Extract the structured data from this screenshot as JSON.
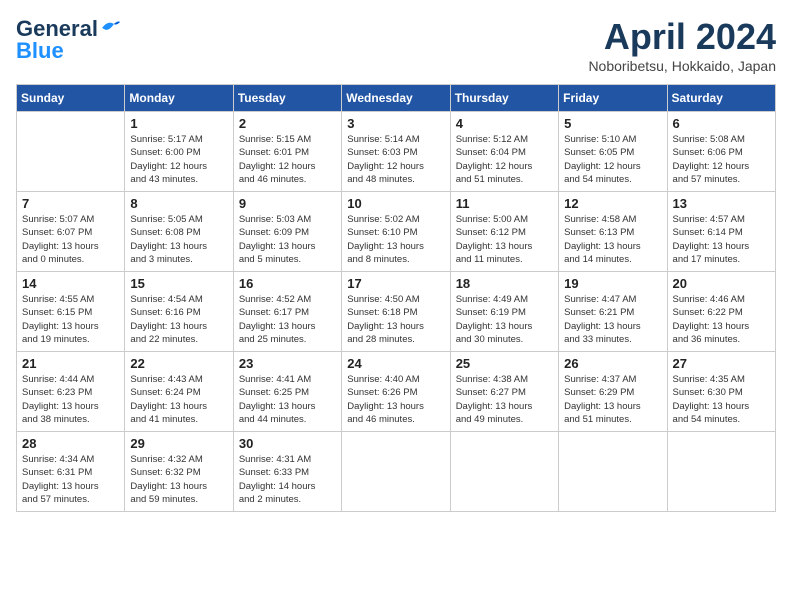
{
  "header": {
    "logo_line1": "General",
    "logo_line2": "Blue",
    "month": "April 2024",
    "location": "Noboribetsu, Hokkaido, Japan"
  },
  "weekdays": [
    "Sunday",
    "Monday",
    "Tuesday",
    "Wednesday",
    "Thursday",
    "Friday",
    "Saturday"
  ],
  "weeks": [
    [
      {
        "day": "",
        "info": ""
      },
      {
        "day": "1",
        "info": "Sunrise: 5:17 AM\nSunset: 6:00 PM\nDaylight: 12 hours\nand 43 minutes."
      },
      {
        "day": "2",
        "info": "Sunrise: 5:15 AM\nSunset: 6:01 PM\nDaylight: 12 hours\nand 46 minutes."
      },
      {
        "day": "3",
        "info": "Sunrise: 5:14 AM\nSunset: 6:03 PM\nDaylight: 12 hours\nand 48 minutes."
      },
      {
        "day": "4",
        "info": "Sunrise: 5:12 AM\nSunset: 6:04 PM\nDaylight: 12 hours\nand 51 minutes."
      },
      {
        "day": "5",
        "info": "Sunrise: 5:10 AM\nSunset: 6:05 PM\nDaylight: 12 hours\nand 54 minutes."
      },
      {
        "day": "6",
        "info": "Sunrise: 5:08 AM\nSunset: 6:06 PM\nDaylight: 12 hours\nand 57 minutes."
      }
    ],
    [
      {
        "day": "7",
        "info": "Sunrise: 5:07 AM\nSunset: 6:07 PM\nDaylight: 13 hours\nand 0 minutes."
      },
      {
        "day": "8",
        "info": "Sunrise: 5:05 AM\nSunset: 6:08 PM\nDaylight: 13 hours\nand 3 minutes."
      },
      {
        "day": "9",
        "info": "Sunrise: 5:03 AM\nSunset: 6:09 PM\nDaylight: 13 hours\nand 5 minutes."
      },
      {
        "day": "10",
        "info": "Sunrise: 5:02 AM\nSunset: 6:10 PM\nDaylight: 13 hours\nand 8 minutes."
      },
      {
        "day": "11",
        "info": "Sunrise: 5:00 AM\nSunset: 6:12 PM\nDaylight: 13 hours\nand 11 minutes."
      },
      {
        "day": "12",
        "info": "Sunrise: 4:58 AM\nSunset: 6:13 PM\nDaylight: 13 hours\nand 14 minutes."
      },
      {
        "day": "13",
        "info": "Sunrise: 4:57 AM\nSunset: 6:14 PM\nDaylight: 13 hours\nand 17 minutes."
      }
    ],
    [
      {
        "day": "14",
        "info": "Sunrise: 4:55 AM\nSunset: 6:15 PM\nDaylight: 13 hours\nand 19 minutes."
      },
      {
        "day": "15",
        "info": "Sunrise: 4:54 AM\nSunset: 6:16 PM\nDaylight: 13 hours\nand 22 minutes."
      },
      {
        "day": "16",
        "info": "Sunrise: 4:52 AM\nSunset: 6:17 PM\nDaylight: 13 hours\nand 25 minutes."
      },
      {
        "day": "17",
        "info": "Sunrise: 4:50 AM\nSunset: 6:18 PM\nDaylight: 13 hours\nand 28 minutes."
      },
      {
        "day": "18",
        "info": "Sunrise: 4:49 AM\nSunset: 6:19 PM\nDaylight: 13 hours\nand 30 minutes."
      },
      {
        "day": "19",
        "info": "Sunrise: 4:47 AM\nSunset: 6:21 PM\nDaylight: 13 hours\nand 33 minutes."
      },
      {
        "day": "20",
        "info": "Sunrise: 4:46 AM\nSunset: 6:22 PM\nDaylight: 13 hours\nand 36 minutes."
      }
    ],
    [
      {
        "day": "21",
        "info": "Sunrise: 4:44 AM\nSunset: 6:23 PM\nDaylight: 13 hours\nand 38 minutes."
      },
      {
        "day": "22",
        "info": "Sunrise: 4:43 AM\nSunset: 6:24 PM\nDaylight: 13 hours\nand 41 minutes."
      },
      {
        "day": "23",
        "info": "Sunrise: 4:41 AM\nSunset: 6:25 PM\nDaylight: 13 hours\nand 44 minutes."
      },
      {
        "day": "24",
        "info": "Sunrise: 4:40 AM\nSunset: 6:26 PM\nDaylight: 13 hours\nand 46 minutes."
      },
      {
        "day": "25",
        "info": "Sunrise: 4:38 AM\nSunset: 6:27 PM\nDaylight: 13 hours\nand 49 minutes."
      },
      {
        "day": "26",
        "info": "Sunrise: 4:37 AM\nSunset: 6:29 PM\nDaylight: 13 hours\nand 51 minutes."
      },
      {
        "day": "27",
        "info": "Sunrise: 4:35 AM\nSunset: 6:30 PM\nDaylight: 13 hours\nand 54 minutes."
      }
    ],
    [
      {
        "day": "28",
        "info": "Sunrise: 4:34 AM\nSunset: 6:31 PM\nDaylight: 13 hours\nand 57 minutes."
      },
      {
        "day": "29",
        "info": "Sunrise: 4:32 AM\nSunset: 6:32 PM\nDaylight: 13 hours\nand 59 minutes."
      },
      {
        "day": "30",
        "info": "Sunrise: 4:31 AM\nSunset: 6:33 PM\nDaylight: 14 hours\nand 2 minutes."
      },
      {
        "day": "",
        "info": ""
      },
      {
        "day": "",
        "info": ""
      },
      {
        "day": "",
        "info": ""
      },
      {
        "day": "",
        "info": ""
      }
    ]
  ]
}
